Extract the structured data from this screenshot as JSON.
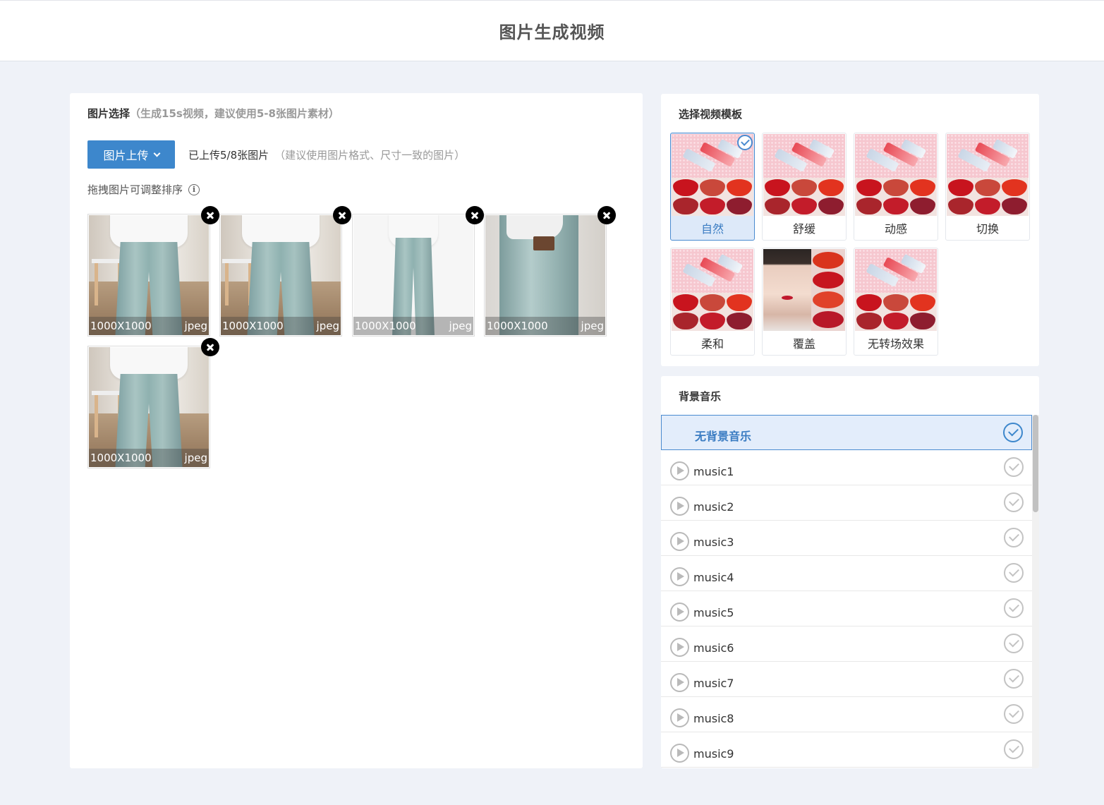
{
  "header": {
    "title": "图片生成视频"
  },
  "images": {
    "title": "图片选择",
    "hint": "（生成15s视频，建议使用5-8张图片素材）",
    "upload_label": "图片上传",
    "uploaded_status": "已上传5/8张图片",
    "uploaded_hint": "（建议使用图片格式、尺寸一致的图片）",
    "drag_tip": "拖拽图片可调整排序",
    "items": [
      {
        "size": "1000X1000",
        "format": "jpeg"
      },
      {
        "size": "1000X1000",
        "format": "jpeg"
      },
      {
        "size": "1000X1000",
        "format": "jpeg"
      },
      {
        "size": "1000X1000",
        "format": "jpeg"
      },
      {
        "size": "1000X1000",
        "format": "jpeg"
      }
    ]
  },
  "templates": {
    "title": "选择视频模板",
    "selected": "自然",
    "items": [
      {
        "label": "自然"
      },
      {
        "label": "舒缓"
      },
      {
        "label": "动感"
      },
      {
        "label": "切换"
      },
      {
        "label": "柔和"
      },
      {
        "label": "覆盖"
      },
      {
        "label": "无转场效果"
      }
    ]
  },
  "music": {
    "title": "背景音乐",
    "none_label": "无背景音乐",
    "selected": "无背景音乐",
    "tracks": [
      {
        "name": "music1"
      },
      {
        "name": "music2"
      },
      {
        "name": "music3"
      },
      {
        "name": "music4"
      },
      {
        "name": "music5"
      },
      {
        "name": "music6"
      },
      {
        "name": "music7"
      },
      {
        "name": "music8"
      },
      {
        "name": "music9"
      }
    ]
  },
  "colors": {
    "accent": "#3d87cc",
    "background": "#eff2f8",
    "selected_fill": "#e3edfb"
  }
}
